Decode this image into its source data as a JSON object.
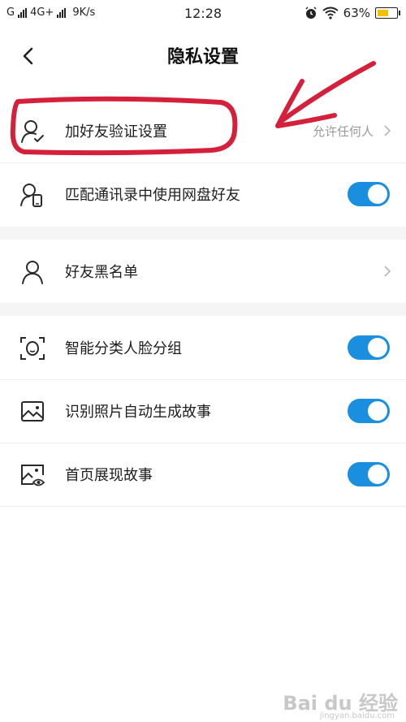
{
  "status_bar": {
    "carrier1": "G",
    "carrier2": "4G+",
    "speed": "9K/s",
    "time": "12:28",
    "battery": "63%",
    "battery_level": 0.63,
    "battery_color": "#f2c200"
  },
  "header": {
    "title": "隐私设置"
  },
  "rows": [
    {
      "label": "加好友验证设置",
      "value": "允许任何人",
      "icon": "person-check-icon"
    },
    {
      "label": "匹配通讯录中使用网盘好友",
      "icon": "person-phone-icon",
      "toggle": true
    },
    {
      "label": "好友黑名单",
      "icon": "person-icon"
    },
    {
      "label": "智能分类人脸分组",
      "icon": "face-scan-icon",
      "toggle": true
    },
    {
      "label": "识别照片自动生成故事",
      "icon": "image-icon",
      "toggle": true
    },
    {
      "label": "首页展现故事",
      "icon": "image-eye-icon",
      "toggle": true
    }
  ],
  "accent_color": "#1a8fdf",
  "annotation_color": "#d4203a",
  "watermark": {
    "brand": "Bai du 经验",
    "url": "jingyan.baidu.com"
  }
}
